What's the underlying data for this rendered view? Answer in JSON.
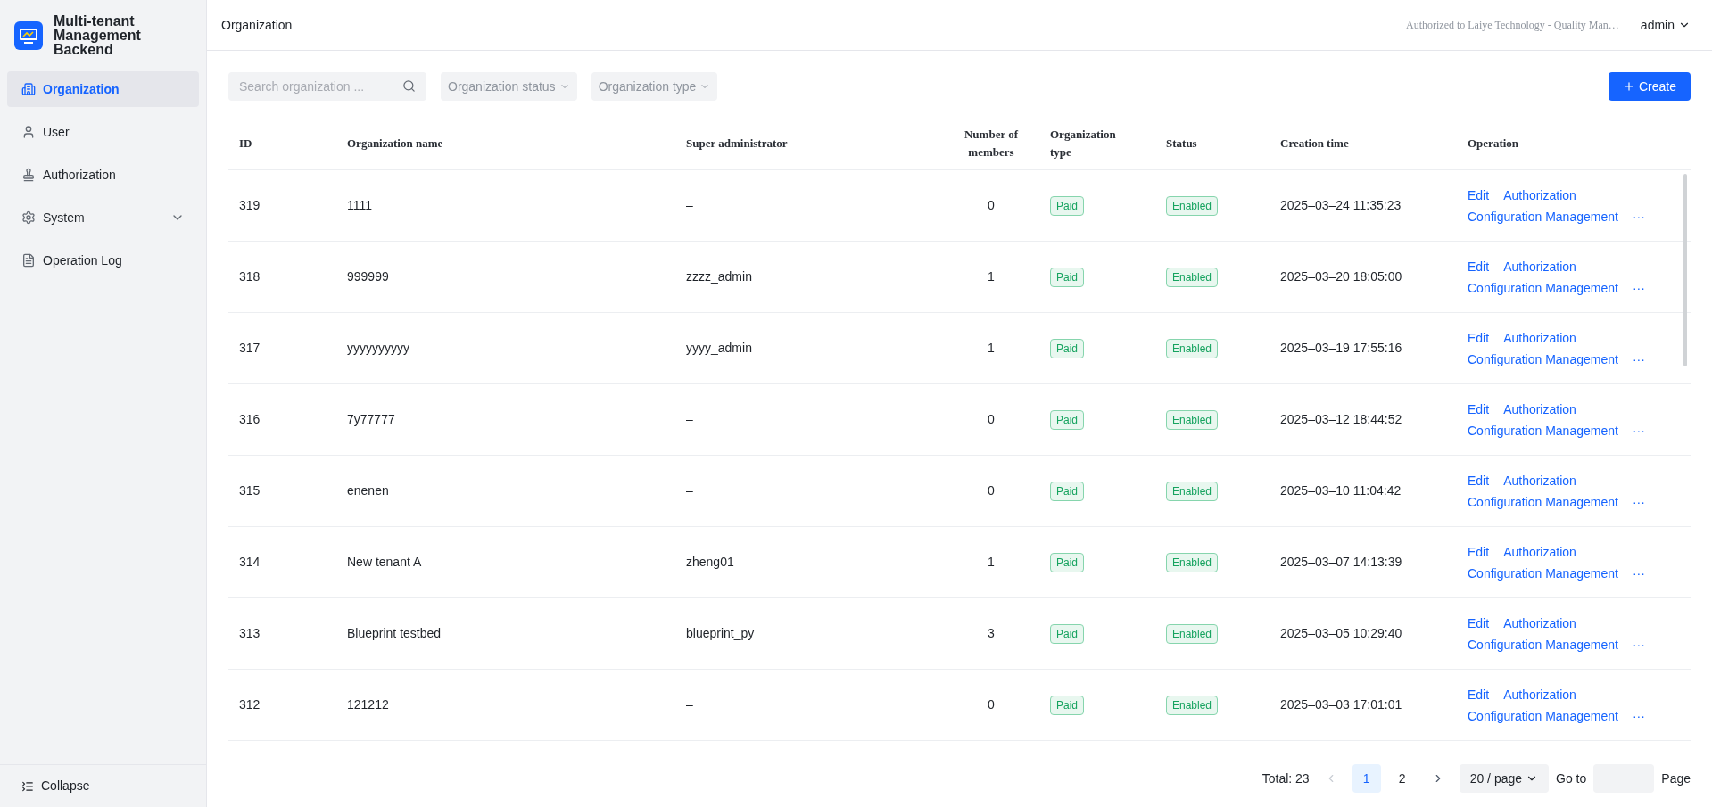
{
  "app": {
    "title": "Multi-tenant Management Backend"
  },
  "sidebar": {
    "items": [
      {
        "label": "Organization",
        "kind": "link",
        "selected": true
      },
      {
        "label": "User",
        "kind": "link",
        "selected": false
      },
      {
        "label": "Authorization",
        "kind": "link",
        "selected": false
      },
      {
        "label": "System",
        "kind": "group",
        "selected": false,
        "expanded": false
      },
      {
        "label": "Operation Log",
        "kind": "link",
        "selected": false
      }
    ],
    "collapse": "Collapse"
  },
  "header": {
    "title": "Organization",
    "license": "Authorized to Laiye Technology - Quality Man…",
    "user": "admin"
  },
  "filters": {
    "search": {
      "placeholder": "Search organization ..."
    },
    "dropdowns": [
      "Organization status",
      "Organization type"
    ],
    "create_button": "Create"
  },
  "table": {
    "columns": [
      "ID",
      "Organization name",
      "Super administrator",
      "Number of members",
      "Organization type",
      "Status",
      "Creation time",
      "Operation"
    ],
    "rows": [
      {
        "id": "319",
        "name": "1111",
        "admin": "–",
        "members": "0",
        "type": "Paid",
        "status": "Enabled",
        "created": "2025–03–24 11:35:23",
        "operations": [
          "Edit",
          "Authorization",
          "Configuration Management",
          "···"
        ]
      },
      {
        "id": "318",
        "name": "999999",
        "admin": "zzzz_admin",
        "members": "1",
        "type": "Paid",
        "status": "Enabled",
        "created": "2025–03–20 18:05:00",
        "operations": [
          "Edit",
          "Authorization",
          "Configuration Management",
          "···"
        ]
      },
      {
        "id": "317",
        "name": "yyyyyyyyyy",
        "admin": "yyyy_admin",
        "members": "1",
        "type": "Paid",
        "status": "Enabled",
        "created": "2025–03–19 17:55:16",
        "operations": [
          "Edit",
          "Authorization",
          "Configuration Management",
          "···"
        ]
      },
      {
        "id": "316",
        "name": "7y77777",
        "admin": "–",
        "members": "0",
        "type": "Paid",
        "status": "Enabled",
        "created": "2025–03–12 18:44:52",
        "operations": [
          "Edit",
          "Authorization",
          "Configuration Management",
          "···"
        ]
      },
      {
        "id": "315",
        "name": "enenen",
        "admin": "–",
        "members": "0",
        "type": "Paid",
        "status": "Enabled",
        "created": "2025–03–10 11:04:42",
        "operations": [
          "Edit",
          "Authorization",
          "Configuration Management",
          "···"
        ]
      },
      {
        "id": "314",
        "name": "New tenant A",
        "admin": "zheng01",
        "members": "1",
        "type": "Paid",
        "status": "Enabled",
        "created": "2025–03–07 14:13:39",
        "operations": [
          "Edit",
          "Authorization",
          "Configuration Management",
          "···"
        ]
      },
      {
        "id": "313",
        "name": "Blueprint testbed",
        "admin": "blueprint_py",
        "members": "3",
        "type": "Paid",
        "status": "Enabled",
        "created": "2025–03–05 10:29:40",
        "operations": [
          "Edit",
          "Authorization",
          "Configuration Management",
          "···"
        ]
      },
      {
        "id": "312",
        "name": "121212",
        "admin": "–",
        "members": "0",
        "type": "Paid",
        "status": "Enabled",
        "created": "2025–03–03 17:01:01",
        "operations": [
          "Edit",
          "Authorization",
          "Configuration Management",
          "···"
        ]
      }
    ]
  },
  "pagination": {
    "total": "Total: 23",
    "pages": [
      {
        "label": "1",
        "selected": true
      },
      {
        "label": "2",
        "selected": false
      }
    ],
    "page_size": "20 / page",
    "goto": "Go to",
    "page": "Page"
  }
}
